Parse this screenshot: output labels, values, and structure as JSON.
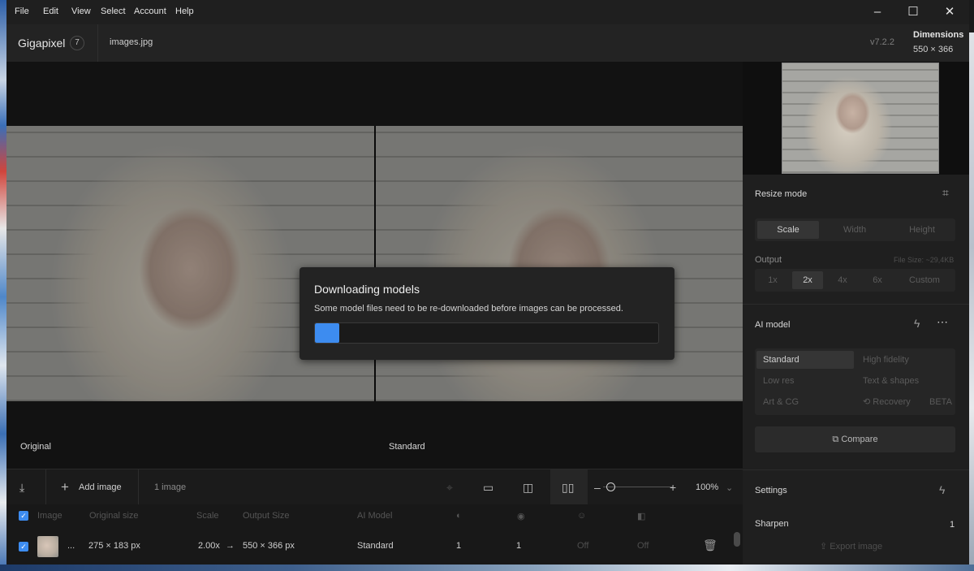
{
  "menu": [
    "File",
    "Edit",
    "View",
    "Select",
    "Account",
    "Help"
  ],
  "header": {
    "app_name": "Gigapixel",
    "badge": "7",
    "file_name": "images.jpg",
    "version": "v7.2.2",
    "dimensions_label": "Dimensions",
    "dimensions_value": "550 × 366"
  },
  "canvas": {
    "left_label": "Original",
    "right_label": "Standard"
  },
  "modal": {
    "title": "Downloading models",
    "message": "Some model files need to be re-downloaded before images can be processed.",
    "progress_percent": 7
  },
  "right_panel": {
    "resize_mode": "Resize mode",
    "resize_tabs": [
      "Scale",
      "Width",
      "Height"
    ],
    "output_label": "Output",
    "file_size": "File Size: ~29,4KB",
    "scale_options": [
      "1x",
      "2x",
      "4x",
      "6x",
      "Custom"
    ],
    "ai_model_label": "AI model",
    "models": [
      "Standard",
      "High fidelity",
      "Low res",
      "Text & shapes",
      "Art & CG",
      "Recovery"
    ],
    "beta": "BETA",
    "compare": "Compare",
    "settings": "Settings",
    "sharpen_label": "Sharpen",
    "sharpen_value": "1",
    "export": "Export image"
  },
  "toolbar": {
    "add_image": "Add image",
    "image_count": "1 image",
    "zoom": "100%"
  },
  "table": {
    "headers": [
      "Image",
      "Original size",
      "Scale",
      "Output Size",
      "AI Model"
    ],
    "row": {
      "more": "...",
      "original_size": "275 × 183 px",
      "scale": "2.00x",
      "arrow": "→",
      "output_size": "550 × 366 px",
      "model": "Standard",
      "v1": "1",
      "v2": "1",
      "v3": "Off",
      "v4": "Off"
    }
  },
  "colors": {
    "accent": "#3d8cf0",
    "beta": "#6aa33a"
  }
}
